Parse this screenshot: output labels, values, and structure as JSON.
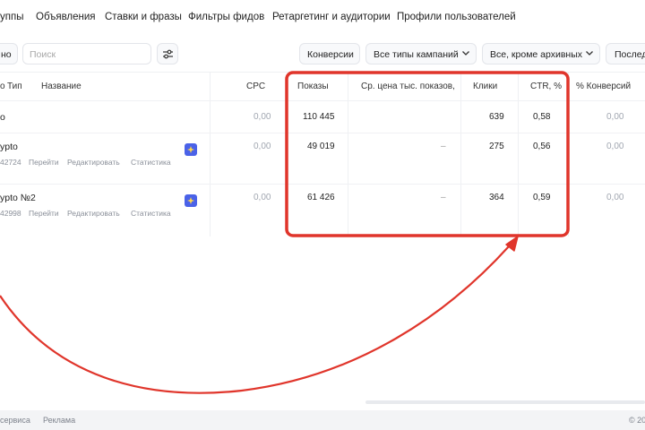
{
  "nav": {
    "items": [
      "уппы",
      "Объявления",
      "Ставки и фразы",
      "Фильтры фидов",
      "Ретаргетинг и аудитории",
      "Профили пользователей"
    ]
  },
  "toolbar": {
    "left_partial": "но",
    "search_placeholder": "Поиск",
    "filter_conversions": "Конверсии",
    "filter_campaign_types": "Все типы кампаний",
    "filter_archive": "Все, кроме архивных",
    "filter_period_partial": "Послед"
  },
  "table": {
    "headers": {
      "partial": "о",
      "type": "Тип",
      "name": "Название",
      "cpc": "CPC",
      "impressions": "Показы",
      "avg_cpm": "Ср. цена тыс. показов,",
      "clicks": "Клики",
      "ctr": "CTR, %",
      "conv_pct": "% Конверсий"
    },
    "total": {
      "label": "о",
      "cpc": "0,00",
      "impressions": "110 445",
      "clicks": "639",
      "ctr": "0,58",
      "conv_pct": "0,00"
    },
    "rows": [
      {
        "name": "ypto",
        "id": "42724",
        "link_go": "Перейти",
        "link_edit": "Редактировать",
        "link_stats": "Статистика",
        "cpc": "0,00",
        "impressions": "49 019",
        "avg_cpm": "–",
        "clicks": "275",
        "ctr": "0,56",
        "conv_pct": "0,00"
      },
      {
        "name": "ypto №2",
        "id": "42998",
        "link_go": "Перейти",
        "link_edit": "Редактировать",
        "link_stats": "Статистика",
        "cpc": "0,00",
        "impressions": "61 426",
        "avg_cpm": "–",
        "clicks": "364",
        "ctr": "0,59",
        "conv_pct": "0,00"
      }
    ]
  },
  "footer": {
    "left_partial": "сервиса",
    "ads": "Реклама",
    "copyright_partial": "© 20"
  },
  "colors": {
    "highlight_red": "#e0352b",
    "campaign_icon": "#4a62e8"
  }
}
